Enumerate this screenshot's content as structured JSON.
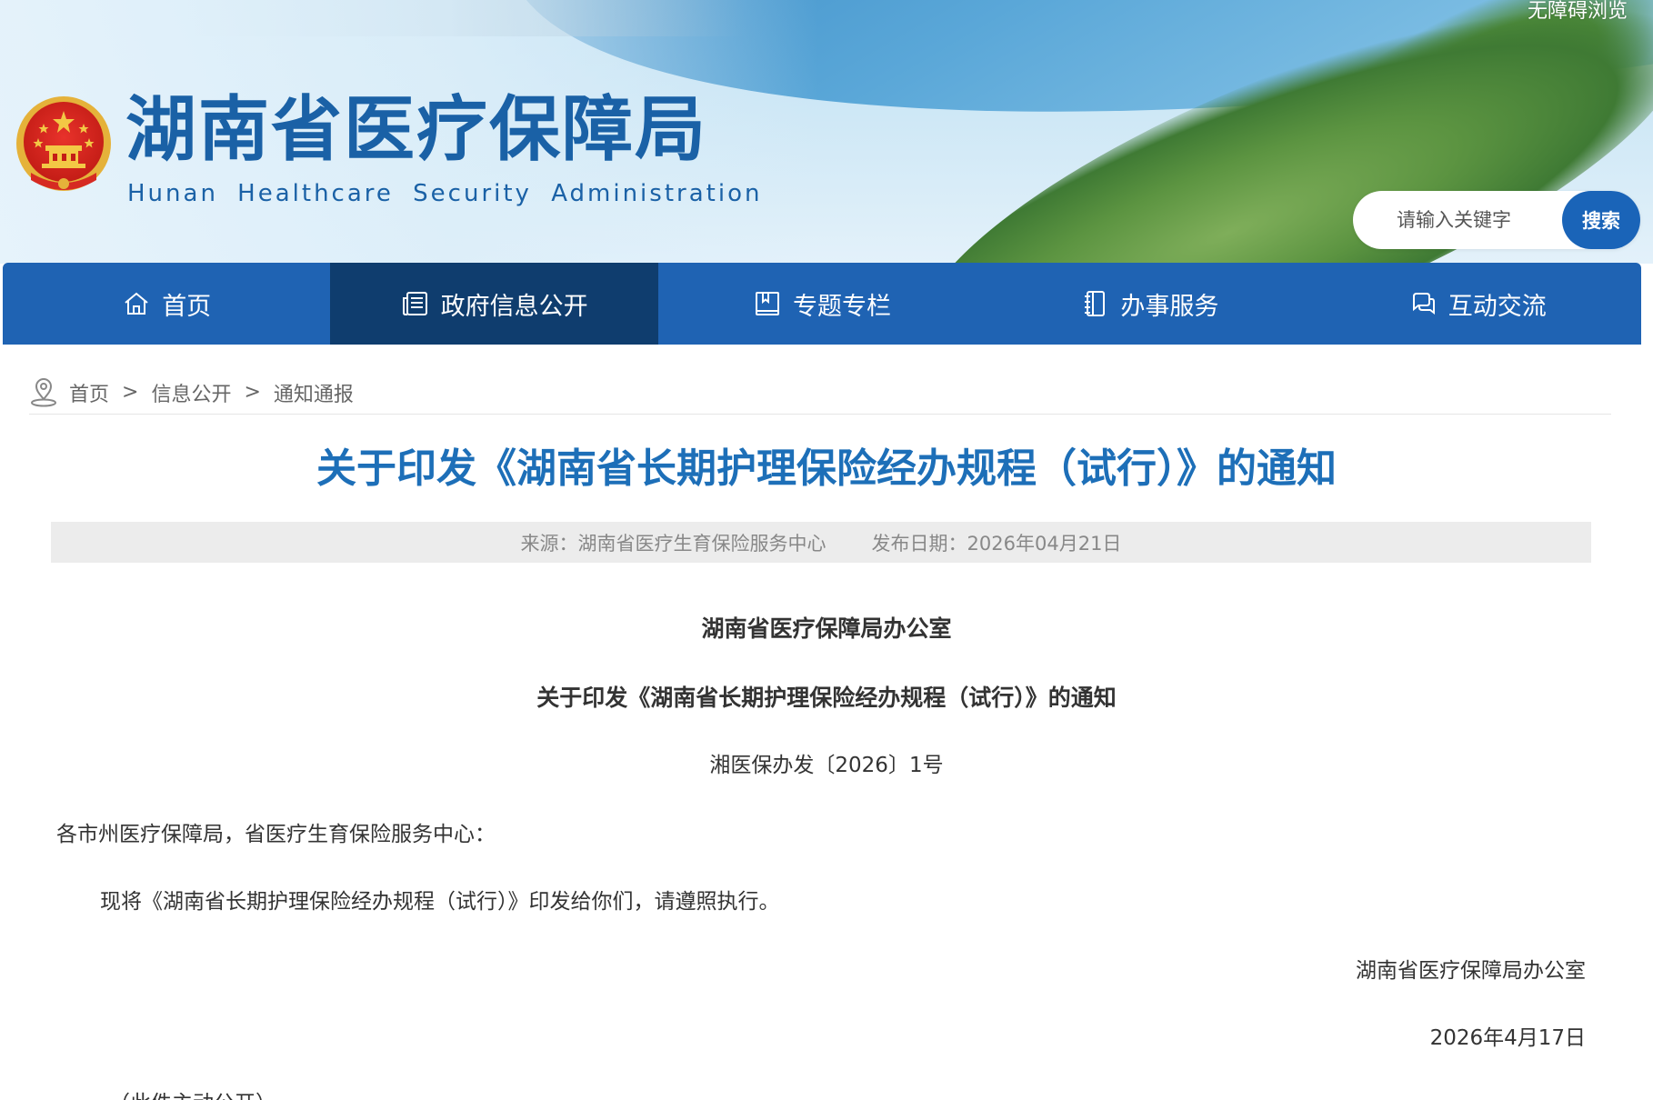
{
  "header": {
    "accessible_browse": "无障碍浏览",
    "site_title": "湖南省医疗保障局",
    "site_subtitle": "Hunan Healthcare Security Administration",
    "search": {
      "placeholder": "请输入关键字",
      "button_label": "搜索"
    }
  },
  "nav": {
    "items": [
      {
        "label": "首页",
        "icon": "home-icon",
        "active": false
      },
      {
        "label": "政府信息公开",
        "icon": "newspaper-icon",
        "active": true
      },
      {
        "label": "专题专栏",
        "icon": "book-icon",
        "active": false
      },
      {
        "label": "办事服务",
        "icon": "notebook-icon",
        "active": false
      },
      {
        "label": "互动交流",
        "icon": "chat-icon",
        "active": false
      }
    ]
  },
  "breadcrumb": {
    "items": [
      "首页",
      "信息公开",
      "通知通报"
    ],
    "separator": ">"
  },
  "article": {
    "title": "关于印发《湖南省长期护理保险经办规程（试行）》的通知",
    "source": "来源：湖南省医疗生育保险服务中心",
    "publish_date": "发布日期：2026年04月21日",
    "org_name": "湖南省医疗保障局办公室",
    "sub_title": "关于印发《湖南省长期护理保险经办规程（试行）》的通知",
    "doc_number": "湘医保办发〔2026〕1号",
    "addressee": "各市州医疗保障局，省医疗生育保险服务中心：",
    "body": "现将《湖南省长期护理保险经办规程（试行）》印发给你们，请遵照执行。",
    "signature": "湖南省医疗保障局办公室",
    "sign_date": "2026年4月17日",
    "public_note": "（此件主动公开）"
  },
  "colors": {
    "nav_bg": "#1f63b3",
    "nav_active_bg": "#0f3d6e",
    "title_blue": "#1d6fb8",
    "brand_blue": "#1a61a6",
    "meta_bar_bg": "#ececec"
  }
}
